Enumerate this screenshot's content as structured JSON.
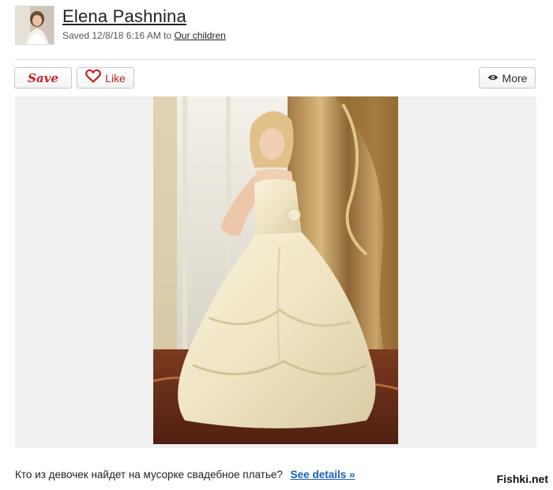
{
  "header": {
    "author": "Elena Pashnina",
    "saved_prefix": "Saved 12/8/18 6:16 AM to",
    "board": "Our children"
  },
  "actions": {
    "save_label": "Save",
    "like_label": "Like",
    "more_label": "More",
    "accent_color": "#cb2027"
  },
  "icons": {
    "like": "heart-icon",
    "more": "eye-icon"
  },
  "caption": {
    "text": "Кто из девочек найдет на мусорке свадебное платье?",
    "link": "See details »"
  },
  "watermark": "Fishki.net"
}
